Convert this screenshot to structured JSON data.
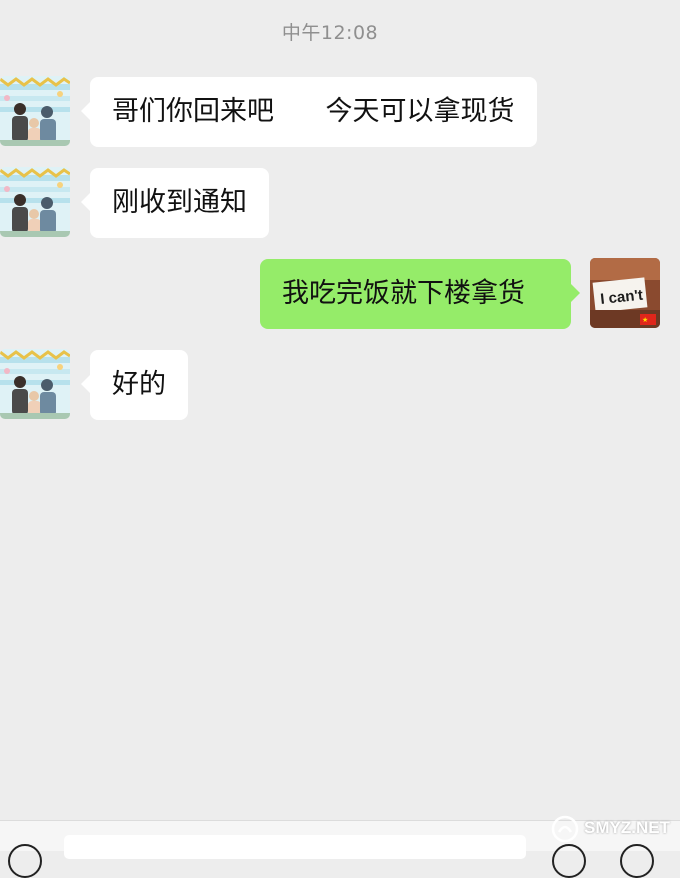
{
  "chat": {
    "timestamp": "中午12:08",
    "messages": [
      {
        "sender": "contact",
        "text": "哥们你回来吧      今天可以拿现货"
      },
      {
        "sender": "contact",
        "text": "刚收到通知"
      },
      {
        "sender": "me",
        "text": "我吃完饭就下楼拿货"
      },
      {
        "sender": "contact",
        "text": "好的"
      }
    ]
  },
  "my_avatar": {
    "caption": "I can't"
  },
  "watermark": {
    "text": "SMYZ.NET"
  },
  "icons": {
    "contact_avatar": "family-illustration-avatar-icon",
    "my_avatar": "i-cant-card-avatar-icon",
    "voice": "voice-toggle-icon",
    "emoji": "emoji-icon",
    "more": "plus-icon"
  },
  "colors": {
    "background": "#ededed",
    "incoming_bubble": "#ffffff",
    "outgoing_bubble": "#95ec69",
    "timestamp_text": "#8f8f8f"
  }
}
